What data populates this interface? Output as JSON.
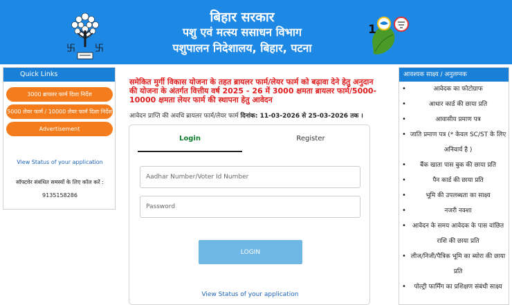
{
  "header": {
    "line1": "बिहार सरकार",
    "line2": "पशु एवं मत्स्य ससाधन विभाग",
    "line3": "पशुपालन निदेशालय, बिहार, पटना",
    "logo_left_icon": "bihar-emblem-icon",
    "logo_right_icon": "centenary-leaf-icon",
    "colors": {
      "header_bg": "#1e88e5",
      "accent_orange": "#f47c1c",
      "panel_head": "#1a7fd6"
    }
  },
  "quick_links": {
    "title": "Quick Links",
    "buttons": [
      "3000 ब्रायलर फार्म दिशा निर्देश",
      "5000 लेयर फार्म / 10000 लेयर फार्म दिशा निर्देश",
      "Advertisement"
    ],
    "status_link": "View Status of your application",
    "helpline_text": "सॉफ्टवेर संबंधित समस्यों के लिए कॉल करें :",
    "helpline_number": "9135158286"
  },
  "notice": {
    "text": "समेकित मुर्गी विकास योजना के तहत ब्रायलर फार्म/लेयर फार्म को बढ़ावा देने हेतु अनुदान की योजना के अंतर्गत वित्तीय वर्ष 2025 - 26 में 3000 क्षमता ब्रायलर फार्म/5000-10000 क्षमता लेयर फार्म की स्थापना हेतु आवेदन",
    "date_prefix": "आवेदन प्राप्ति की अवधि ब्रायलर फार्म/लेयर फार्म ",
    "date_bold": "दिनांक: 11-03-2026 से 25-03-2026 तक ।"
  },
  "login_card": {
    "tab_login": "Login",
    "tab_register": "Register",
    "id_placeholder": "Aadhar Number/Voter Id Number",
    "password_placeholder": "Password",
    "login_button": "LOGIN",
    "status_link": "View Status of your application"
  },
  "documents": {
    "title": "आवश्यक साक्ष्य / अनुलग्नक",
    "items": [
      "आवेदक का फोटोग्राफ",
      "आधार कार्ड की छाया प्रति",
      "आवासीय प्रमाण पत्र",
      "जाति प्रमाण पत्र (* केवल SC/ST के लिए अनिवार्य है )",
      "बैंक खाता पास बुक की छाया प्रति",
      "पैन कार्ड की छाया प्रति",
      "भूमि की उपलब्धता का साक्ष्य",
      "नजरी नक्शा",
      "आवेदन के समय आवेदक के पास वांछित राशि की छाया प्रति",
      "लीज/निजी/पैत्रिक भूमि का ब्योरा की छाया प्रति",
      "पोल्ट्री फार्मिंग का प्रशिक्षण संबंधी साक्ष्य"
    ]
  }
}
